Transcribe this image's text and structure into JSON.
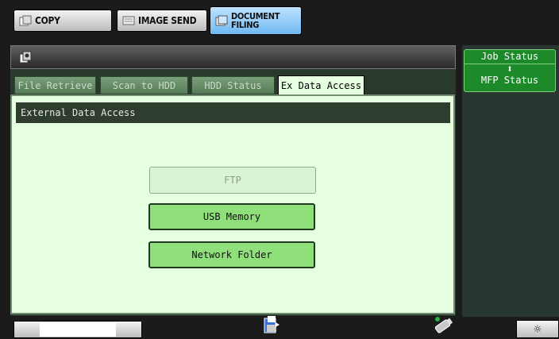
{
  "modes": {
    "copy": "COPY",
    "image_send": "IMAGE SEND",
    "document_filing_line1": "DOCUMENT",
    "document_filing_line2": "FILING"
  },
  "tabs": [
    {
      "label": "File Retrieve"
    },
    {
      "label": "Scan to HDD"
    },
    {
      "label": "HDD Status"
    },
    {
      "label": "Ex Data Access"
    }
  ],
  "panel": {
    "heading": "External Data Access",
    "buttons": [
      {
        "label": "FTP",
        "enabled": false
      },
      {
        "label": "USB Memory",
        "enabled": true
      },
      {
        "label": "Network Folder",
        "enabled": true
      }
    ]
  },
  "status": {
    "job_status": "Job Status",
    "arrows": "⬍",
    "mfp_status": "MFP Status"
  },
  "colors": {
    "panel_bg": "#e6ffe0",
    "active_button": "#8fe07a",
    "heading_bg": "#2e3d2e",
    "status_button": "#1d8a2a"
  },
  "bottom": {
    "brightness_icon": "☼"
  }
}
